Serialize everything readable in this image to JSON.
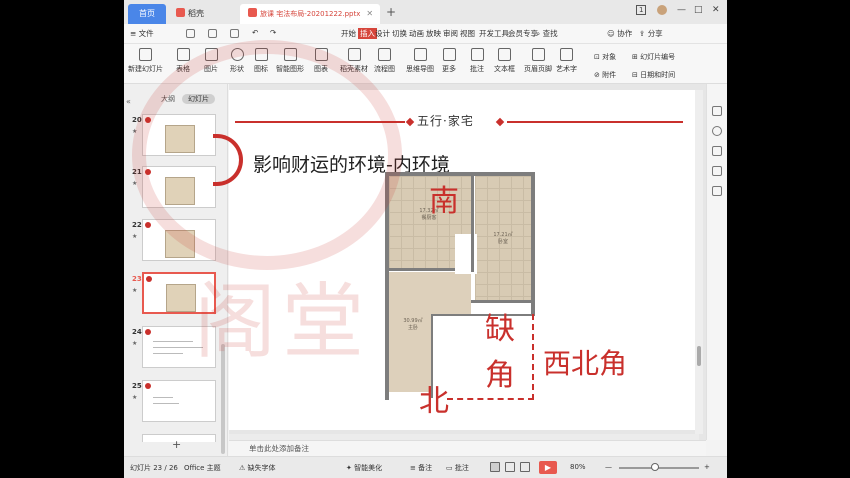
{
  "titlebar": {
    "tabs": [
      {
        "label": "首页",
        "active": false
      },
      {
        "label": "稻壳",
        "active": false
      },
      {
        "label": "旅课 宅法布局-20201222.pptx",
        "active": true
      }
    ],
    "window_controls": {
      "badge": "1",
      "minimize": "—",
      "maximize": "□",
      "close": "✕"
    }
  },
  "menu": {
    "file": "文件",
    "items": [
      "开始",
      "插入",
      "设计",
      "切换",
      "动画",
      "放映",
      "审阅",
      "视图",
      "开发工具",
      "会员专享"
    ],
    "active_item": "插入",
    "search": "查找",
    "collab": "协作",
    "share": "分享"
  },
  "ribbon": {
    "buttons": [
      "新建幻灯片",
      "表格",
      "图片",
      "形状",
      "图标",
      "智能图形",
      "图表",
      "稻壳素材",
      "流程图",
      "思维导图",
      "更多",
      "批注",
      "文本框",
      "页眉页脚",
      "艺术字"
    ],
    "right_small": [
      "对象",
      "幻灯片编号",
      "附件",
      "日期和时间"
    ]
  },
  "left_panel": {
    "tab_outline": "大纲",
    "tab_slides": "幻灯片",
    "thumbnails": [
      {
        "num": "20",
        "selected": false
      },
      {
        "num": "21",
        "selected": false
      },
      {
        "num": "22",
        "selected": false
      },
      {
        "num": "23",
        "selected": true
      },
      {
        "num": "24",
        "selected": false
      },
      {
        "num": "25",
        "selected": false
      }
    ],
    "add_symbol": "+"
  },
  "slide": {
    "header": "五行·家宅",
    "title": "影响财运的环境-内环境",
    "plan_rooms": [
      {
        "line1": "17.32㎡",
        "line2": "餐厨客"
      },
      {
        "line1": "17.21㎡",
        "line2": "卧室"
      },
      {
        "line1": "30.99㎡",
        "line2": "主卧"
      }
    ],
    "labels": {
      "south": "南",
      "north": "北",
      "missing1": "缺",
      "missing2": "角",
      "northwest": "西北角"
    },
    "watermark": "阁堂"
  },
  "notes_placeholder": "单击此处添加备注",
  "statusbar": {
    "slide_count": "幻灯片 23 / 26",
    "theme": "Office 主题",
    "missing_font": "缺失字体",
    "smart_beautify": "智能美化",
    "notes": "备注",
    "comments": "批注",
    "zoom": "80%",
    "minus": "—",
    "plus": "+"
  },
  "colors": {
    "accent_red": "#c9302c",
    "home_tab_blue": "#4a86e8"
  }
}
